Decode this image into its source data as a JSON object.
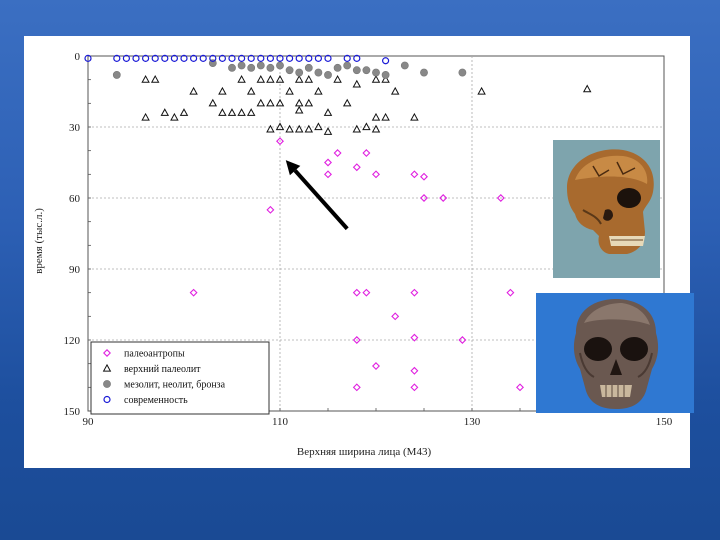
{
  "chart_data": {
    "type": "scatter",
    "title": "",
    "xlabel": "Верхняя ширина лица (М43)",
    "ylabel": "время (тыс.л.)",
    "xlim": [
      90,
      150
    ],
    "ylim": [
      0,
      150
    ],
    "y_inverted": true,
    "xticks": [
      "90",
      "110",
      "130",
      "150"
    ],
    "yticks": [
      "0",
      "30",
      "60",
      "90",
      "120",
      "150"
    ],
    "grid": true,
    "legend_position": "bottom-left",
    "series": [
      {
        "name": "палеоантропы",
        "marker": "diamond",
        "color": "#e020e0",
        "points": [
          [
            110,
            36
          ],
          [
            116,
            41
          ],
          [
            119,
            41
          ],
          [
            115,
            45
          ],
          [
            118,
            47
          ],
          [
            115,
            50
          ],
          [
            120,
            50
          ],
          [
            124,
            50
          ],
          [
            125,
            51
          ],
          [
            109,
            65
          ],
          [
            125,
            60
          ],
          [
            127,
            60
          ],
          [
            133,
            60
          ],
          [
            101,
            100
          ],
          [
            118,
            100
          ],
          [
            119,
            100
          ],
          [
            124,
            100
          ],
          [
            134,
            100
          ],
          [
            122,
            110
          ],
          [
            118,
            120
          ],
          [
            124,
            119
          ],
          [
            129,
            120
          ],
          [
            120,
            131
          ],
          [
            124,
            133
          ],
          [
            118,
            140
          ],
          [
            124,
            140
          ],
          [
            135,
            140
          ]
        ]
      },
      {
        "name": "верхний палеолит",
        "marker": "triangle",
        "color": "#111111",
        "points": [
          [
            96,
            10
          ],
          [
            97,
            10
          ],
          [
            101,
            15
          ],
          [
            104,
            15
          ],
          [
            106,
            10
          ],
          [
            107,
            15
          ],
          [
            108,
            10
          ],
          [
            109,
            10
          ],
          [
            110,
            10
          ],
          [
            111,
            15
          ],
          [
            112,
            10
          ],
          [
            113,
            10
          ],
          [
            114,
            15
          ],
          [
            116,
            10
          ],
          [
            118,
            12
          ],
          [
            120,
            10
          ],
          [
            121,
            10
          ],
          [
            122,
            15
          ],
          [
            131,
            15
          ],
          [
            142,
            14
          ],
          [
            96,
            26
          ],
          [
            98,
            24
          ],
          [
            99,
            26
          ],
          [
            100,
            24
          ],
          [
            103,
            20
          ],
          [
            104,
            24
          ],
          [
            105,
            24
          ],
          [
            106,
            24
          ],
          [
            107,
            24
          ],
          [
            108,
            20
          ],
          [
            109,
            20
          ],
          [
            110,
            20
          ],
          [
            112,
            20
          ],
          [
            113,
            20
          ],
          [
            112,
            23
          ],
          [
            115,
            24
          ],
          [
            117,
            20
          ],
          [
            120,
            26
          ],
          [
            121,
            26
          ],
          [
            124,
            26
          ],
          [
            111,
            31
          ],
          [
            112,
            31
          ],
          [
            113,
            31
          ],
          [
            114,
            30
          ],
          [
            115,
            32
          ],
          [
            118,
            31
          ],
          [
            119,
            30
          ],
          [
            120,
            31
          ],
          [
            110,
            30
          ],
          [
            109,
            31
          ]
        ]
      },
      {
        "name": "мезолит, неолит, бронза",
        "marker": "circle-filled",
        "color": "#888888",
        "points": [
          [
            93,
            8
          ],
          [
            103,
            3
          ],
          [
            105,
            5
          ],
          [
            106,
            4
          ],
          [
            107,
            5
          ],
          [
            108,
            4
          ],
          [
            109,
            5
          ],
          [
            110,
            4
          ],
          [
            111,
            6
          ],
          [
            112,
            7
          ],
          [
            113,
            5
          ],
          [
            114,
            7
          ],
          [
            115,
            8
          ],
          [
            116,
            5
          ],
          [
            117,
            4
          ],
          [
            118,
            6
          ],
          [
            119,
            6
          ],
          [
            120,
            7
          ],
          [
            121,
            8
          ],
          [
            123,
            4
          ],
          [
            125,
            7
          ],
          [
            129,
            7
          ]
        ]
      },
      {
        "name": "современность",
        "marker": "circle-open",
        "color": "#1a1ad6",
        "points": [
          [
            90,
            1
          ],
          [
            93,
            1
          ],
          [
            94,
            1
          ],
          [
            95,
            1
          ],
          [
            96,
            1
          ],
          [
            97,
            1
          ],
          [
            98,
            1
          ],
          [
            99,
            1
          ],
          [
            100,
            1
          ],
          [
            101,
            1
          ],
          [
            102,
            1
          ],
          [
            103,
            1
          ],
          [
            104,
            1
          ],
          [
            105,
            1
          ],
          [
            106,
            1
          ],
          [
            107,
            1
          ],
          [
            108,
            1
          ],
          [
            109,
            1
          ],
          [
            110,
            1
          ],
          [
            111,
            1
          ],
          [
            112,
            1
          ],
          [
            113,
            1
          ],
          [
            114,
            1
          ],
          [
            115,
            1
          ],
          [
            117,
            1
          ],
          [
            118,
            1
          ],
          [
            121,
            2
          ]
        ]
      }
    ],
    "annotation": {
      "type": "arrow",
      "from": [
        117,
        73
      ],
      "to": [
        110.6,
        44
      ]
    }
  },
  "images": [
    {
      "name": "skull-photo-side",
      "description": "fossil skull photo, side view",
      "color": "#b27635"
    },
    {
      "name": "skull-photo-front",
      "description": "fossil skull photo, front view",
      "color": "#5b4b43"
    }
  ]
}
